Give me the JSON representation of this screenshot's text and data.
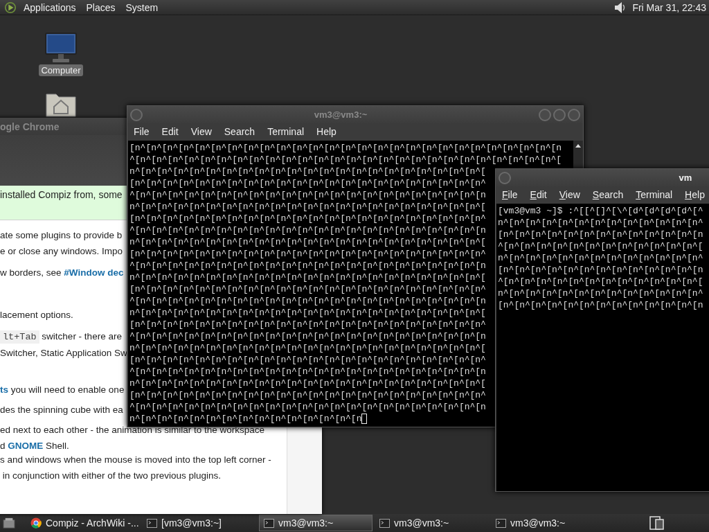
{
  "top_panel": {
    "menus": [
      "Applications",
      "Places",
      "System"
    ],
    "clock": "Fri Mar 31, 22:43"
  },
  "desktop_icons": [
    {
      "kind": "computer",
      "label": "Computer",
      "selected": true
    },
    {
      "kind": "home",
      "selected": false
    }
  ],
  "browser_window": {
    "title": "ogle Chrome",
    "notice": "installed Compiz from, some",
    "paragraphs": [
      [
        [
          {
            "kind": "text",
            "text": "ate some plugins to provide b"
          }
        ],
        [
          {
            "kind": "text",
            "text": "e or close any windows. Impo"
          }
        ]
      ],
      [
        [
          {
            "kind": "text",
            "text": "w borders, see "
          },
          {
            "kind": "link",
            "text": "#Window dec"
          }
        ]
      ],
      [
        [
          {
            "kind": "text",
            "text": "lacement options."
          }
        ]
      ],
      [
        [
          {
            "kind": "code",
            "text": "lt+Tab"
          },
          {
            "kind": "text",
            "text": " switcher - there are"
          }
        ],
        [
          {
            "kind": "text",
            "text": "Switcher, Static Application Sw"
          }
        ]
      ],
      [
        [
          {
            "kind": "link",
            "text": "ts"
          },
          {
            "kind": "text",
            "text": " you will need to enable one"
          }
        ]
      ],
      [
        [
          {
            "kind": "text",
            "text": "des the spinning cube with ea"
          }
        ]
      ],
      [
        [
          {
            "kind": "text",
            "text": "ed next to each other - the animation is similar to the workspace"
          }
        ],
        [
          {
            "kind": "text",
            "text": "d "
          },
          {
            "kind": "link",
            "text": "GNOME"
          },
          {
            "kind": "text",
            "text": " Shell."
          }
        ]
      ],
      [
        [
          {
            "kind": "text",
            "text": "s and windows when the mouse is moved into the top left corner -"
          }
        ],
        [
          {
            "kind": "text",
            "text": " in conjunction with either of the two previous plugins."
          }
        ]
      ]
    ]
  },
  "terminals": [
    {
      "title": "vm3@vm3:~",
      "active": false,
      "cursor": true,
      "menu": [
        "File",
        "Edit",
        "View",
        "Search",
        "Terminal",
        "Help"
      ],
      "lines": [
        "[n^[n^[n^[n^[n^[n^[n^[n^[n^[n^[n^[n^[n^[n^[n^[n^[n^[n^[n^[n^[n^[n^[n^[n^[n^[n^[n",
        "^[n^[n^[n^[n^[n^[n^[n^[n^[n^[n^[n^[n^[n^[n^[n^[n^[n^[n^[n^[n^[n^[n^[n^[n^[n^[n^[",
        "n^[n^[n^[n^[n^[n^[n^[n^[n^[n^[n^[n^[n^[n^[n^[n^[n^[n^[n^[n^[n^[n^[",
        "[n^[n^[n^[n^[n^[n^[n^[n^[n^[n^[n^[n^[n^[n^[n^[n^[n^[n^[n^[n^[n^[n^",
        "^[n^[n^[n^[n^[n^[n^[n^[n^[n^[n^[n^[n^[n^[n^[n^[n^[n^[n^[n^[n^[n^[n",
        "n^[n^[n^[n^[n^[n^[n^[n^[n^[n^[n^[n^[n^[n^[n^[n^[n^[n^[n^[n^[n^[n^[",
        "[n^[n^[n^[n^[n^[n^[n^[n^[n^[n^[n^[n^[n^[n^[n^[n^[n^[n^[n^[n^[n^[n^",
        "^[n^[n^[n^[n^[n^[n^[n^[n^[n^[n^[n^[n^[n^[n^[n^[n^[n^[n^[n^[n^[n^[n",
        "n^[n^[n^[n^[n^[n^[n^[n^[n^[n^[n^[n^[n^[n^[n^[n^[n^[n^[n^[n^[n^[n^[",
        "[n^[n^[n^[n^[n^[n^[n^[n^[n^[n^[n^[n^[n^[n^[n^[n^[n^[n^[n^[n^[n^[n^",
        "^[n^[n^[n^[n^[n^[n^[n^[n^[n^[n^[n^[n^[n^[n^[n^[n^[n^[n^[n^[n^[n^[n",
        "n^[n^[n^[n^[n^[n^[n^[n^[n^[n^[n^[n^[n^[n^[n^[n^[n^[n^[n^[n^[n^[n^[",
        "[n^[n^[n^[n^[n^[n^[n^[n^[n^[n^[n^[n^[n^[n^[n^[n^[n^[n^[n^[n^[n^[n^",
        "^[n^[n^[n^[n^[n^[n^[n^[n^[n^[n^[n^[n^[n^[n^[n^[n^[n^[n^[n^[n^[n^[n",
        "n^[n^[n^[n^[n^[n^[n^[n^[n^[n^[n^[n^[n^[n^[n^[n^[n^[n^[n^[n^[n^[n^[",
        "[n^[n^[n^[n^[n^[n^[n^[n^[n^[n^[n^[n^[n^[n^[n^[n^[n^[n^[n^[n^[n^[n^",
        "^[n^[n^[n^[n^[n^[n^[n^[n^[n^[n^[n^[n^[n^[n^[n^[n^[n^[n^[n^[n^[n^[n",
        "n^[n^[n^[n^[n^[n^[n^[n^[n^[n^[n^[n^[n^[n^[n^[n^[n^[n^[n^[n^[n^[n^[",
        "[n^[n^[n^[n^[n^[n^[n^[n^[n^[n^[n^[n^[n^[n^[n^[n^[n^[n^[n^[n^[n^[n^",
        "^[n^[n^[n^[n^[n^[n^[n^[n^[n^[n^[n^[n^[n^[n^[n^[n^[n^[n^[n^[n^[n^[n",
        "n^[n^[n^[n^[n^[n^[n^[n^[n^[n^[n^[n^[n^[n^[n^[n^[n^[n^[n^[n^[n^[n^[",
        "[n^[n^[n^[n^[n^[n^[n^[n^[n^[n^[n^[n^[n^[n^[n^[n^[n^[n^[n^[n^[n^[n^",
        "^[n^[n^[n^[n^[n^[n^[n^[n^[n^[n^[n^[n^[n^[n^[n^[n^[n^[n^[n^[n^[n^[n",
        "n^[n^[n^[n^[n^[n^[n^[n^[n^[n^[n^[n^[n^[n^[n"
      ]
    },
    {
      "title": "vm",
      "active": true,
      "cursor": false,
      "menu": [
        "File",
        "Edit",
        "View",
        "Search",
        "Terminal",
        "Help"
      ],
      "lines": [
        "[vm3@vm3 ~]$ :^[[^[]^[\\^[d^[d^[d^[d^[^",
        "n^[n^[n^[n^[n^[n^[n^[n^[n^[n^[n^[n^[n^",
        "[n^[n^[n^[n^[n^[n^[n^[n^[n^[n^[n^[n^[n",
        "^[n^[n^[n^[n^[n^[n^[n^[n^[n^[n^[n^[n^[",
        "n^[n^[n^[n^[n^[n^[n^[n^[n^[n^[n^[n^[n^",
        "[n^[n^[n^[n^[n^[n^[n^[n^[n^[n^[n^[n^[n",
        "^[n^[n^[n^[n^[n^[n^[n^[n^[n^[n^[n^[n^[",
        "n^[n^[n^[n^[n^[n^[n^[n^[n^[n^[n^[n^[n^",
        "[n^[n^[n^[n^[n^[n^[n^[n^[n^[n^[n^[n^[n"
      ]
    }
  ],
  "taskbar": {
    "items": [
      {
        "kind": "browser",
        "label": "Compiz - ArchWiki -...",
        "selected": false
      },
      {
        "kind": "terminal",
        "label": "[vm3@vm3:~]",
        "selected": false
      },
      {
        "kind": "terminal",
        "label": "vm3@vm3:~",
        "selected": true
      },
      {
        "kind": "terminal",
        "label": "vm3@vm3:~",
        "selected": false
      },
      {
        "kind": "terminal",
        "label": "vm3@vm3:~",
        "selected": false
      }
    ]
  }
}
